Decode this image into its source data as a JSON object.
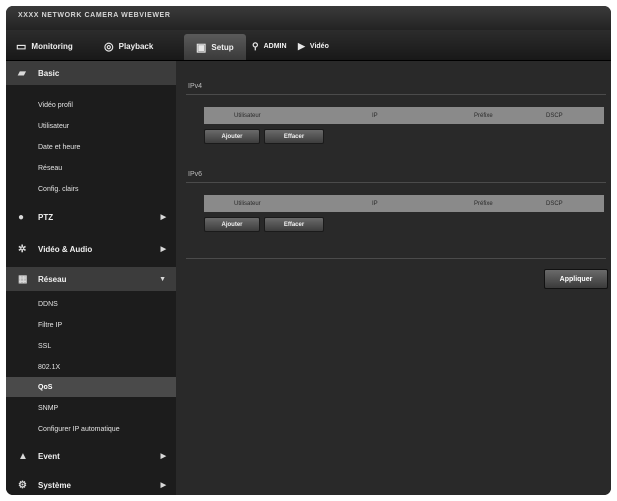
{
  "window": {
    "title": "XXXX NETWORK CAMERA WEBVIEWER"
  },
  "nav": {
    "monitoring": "Monitoring",
    "playback": "Playback",
    "setup": "Setup",
    "admin": "ADMIN",
    "video": "Vidéo"
  },
  "sidebar": {
    "basic": {
      "label": "Basic",
      "icon": "basic-icon",
      "items": [
        "Vidéo profil",
        "Utilisateur",
        "Date et heure",
        "Réseau",
        "Config. clairs"
      ]
    },
    "ptz": {
      "label": "PTZ",
      "icon": "ptz-icon"
    },
    "video_audio": {
      "label": "Vidéo & Audio",
      "icon": "video-audio-icon"
    },
    "network": {
      "label": "Réseau",
      "icon": "network-icon",
      "items": [
        "DDNS",
        "Filtre IP",
        "SSL",
        "802.1X",
        "QoS",
        "SNMP",
        "Configurer IP automatique"
      ],
      "selected": "QoS"
    },
    "event": {
      "label": "Event",
      "icon": "event-icon"
    },
    "system": {
      "label": "Système",
      "icon": "system-icon"
    }
  },
  "content": {
    "ipv4": {
      "title": "IPv4",
      "columns": [
        "Utilisateur",
        "IP",
        "Préfixe",
        "DSCP"
      ],
      "add_label": "Ajouter",
      "delete_label": "Effacer"
    },
    "ipv6": {
      "title": "IPv6",
      "columns": [
        "Utilisateur",
        "IP",
        "Préfixe",
        "DSCP"
      ],
      "add_label": "Ajouter",
      "delete_label": "Effacer"
    },
    "apply_label": "Appliquer"
  }
}
